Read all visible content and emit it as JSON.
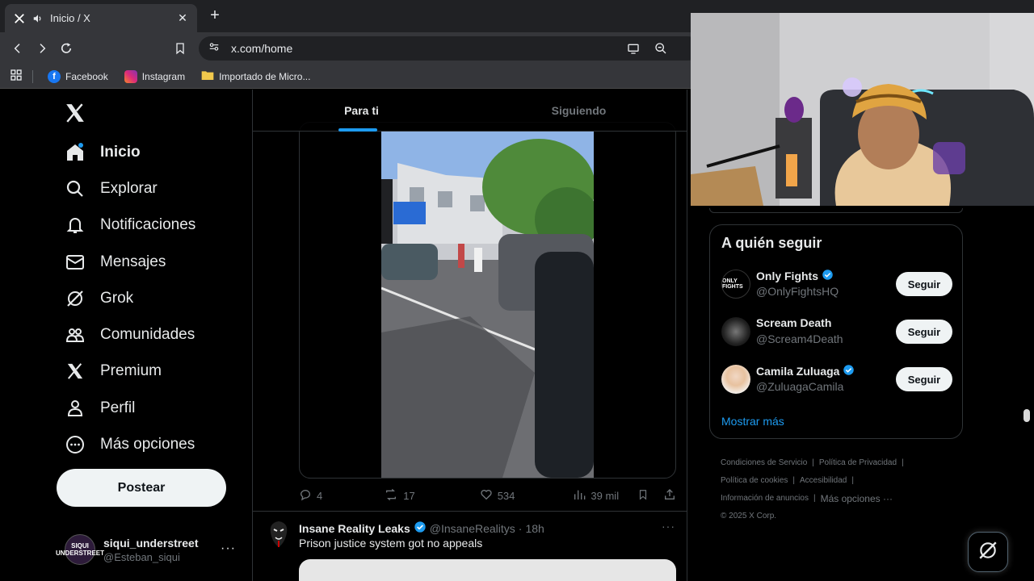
{
  "browser": {
    "tab_title": "Inicio / X",
    "new_tab_symbol": "+",
    "close_symbol": "✕",
    "url": "x.com/home",
    "bookmarks": [
      {
        "label": "Facebook",
        "color": "#1877f2"
      },
      {
        "label": "Instagram",
        "color": "#e1306c"
      },
      {
        "label": "Importado de Micro...",
        "color": "#f2c94c"
      }
    ]
  },
  "sidebar": {
    "items": [
      {
        "label": "Inicio",
        "icon": "home-icon",
        "active": true
      },
      {
        "label": "Explorar",
        "icon": "search-icon"
      },
      {
        "label": "Notificaciones",
        "icon": "bell-icon"
      },
      {
        "label": "Mensajes",
        "icon": "mail-icon"
      },
      {
        "label": "Grok",
        "icon": "grok-icon"
      },
      {
        "label": "Comunidades",
        "icon": "communities-icon"
      },
      {
        "label": "Premium",
        "icon": "x-premium-icon"
      },
      {
        "label": "Perfil",
        "icon": "person-icon"
      },
      {
        "label": "Más opciones",
        "icon": "more-circle-icon"
      }
    ],
    "post_button": "Postear",
    "account": {
      "name": "siqui_understreet",
      "handle": "@Esteban_siqui",
      "avatar_text": "SIQUI UNDERSTREET",
      "more": "···"
    }
  },
  "feed": {
    "tabs": [
      {
        "label": "Para ti",
        "active": true
      },
      {
        "label": "Siguiendo",
        "active": false
      }
    ],
    "tweet1": {
      "replies": "4",
      "reposts": "17",
      "likes": "534",
      "views": "39 mil"
    },
    "tweet2": {
      "name": "Insane Reality Leaks",
      "handle": "@InsaneRealitys",
      "dot": "·",
      "time": "18h",
      "text": "Prison justice system got no appeals",
      "more": "···"
    }
  },
  "right": {
    "follow_title": "A quién seguir",
    "follow_button": "Seguir",
    "accounts": [
      {
        "name": "Only Fights",
        "handle": "@OnlyFightsHQ",
        "verified": true,
        "avatar_text": "ONLY FIGHTS"
      },
      {
        "name": "Scream Death",
        "handle": "@Scream4Death",
        "verified": false,
        "avatar_text": ""
      },
      {
        "name": "Camila Zuluaga",
        "handle": "@ZuluagaCamila",
        "verified": true,
        "avatar_text": ""
      }
    ],
    "show_more": "Mostrar más",
    "footer": {
      "terms": "Condiciones de Servicio",
      "privacy": "Política de Privacidad",
      "cookies": "Política de cookies",
      "accessibility": "Accesibilidad",
      "ads": "Información de anuncios",
      "more": "Más opciones ···",
      "copyright": "© 2025 X Corp.",
      "sep": "|"
    }
  },
  "colors": {
    "accent": "#1d9bf0",
    "text_primary": "#e7e9ea",
    "text_secondary": "#71767b",
    "border": "#2f3336"
  }
}
